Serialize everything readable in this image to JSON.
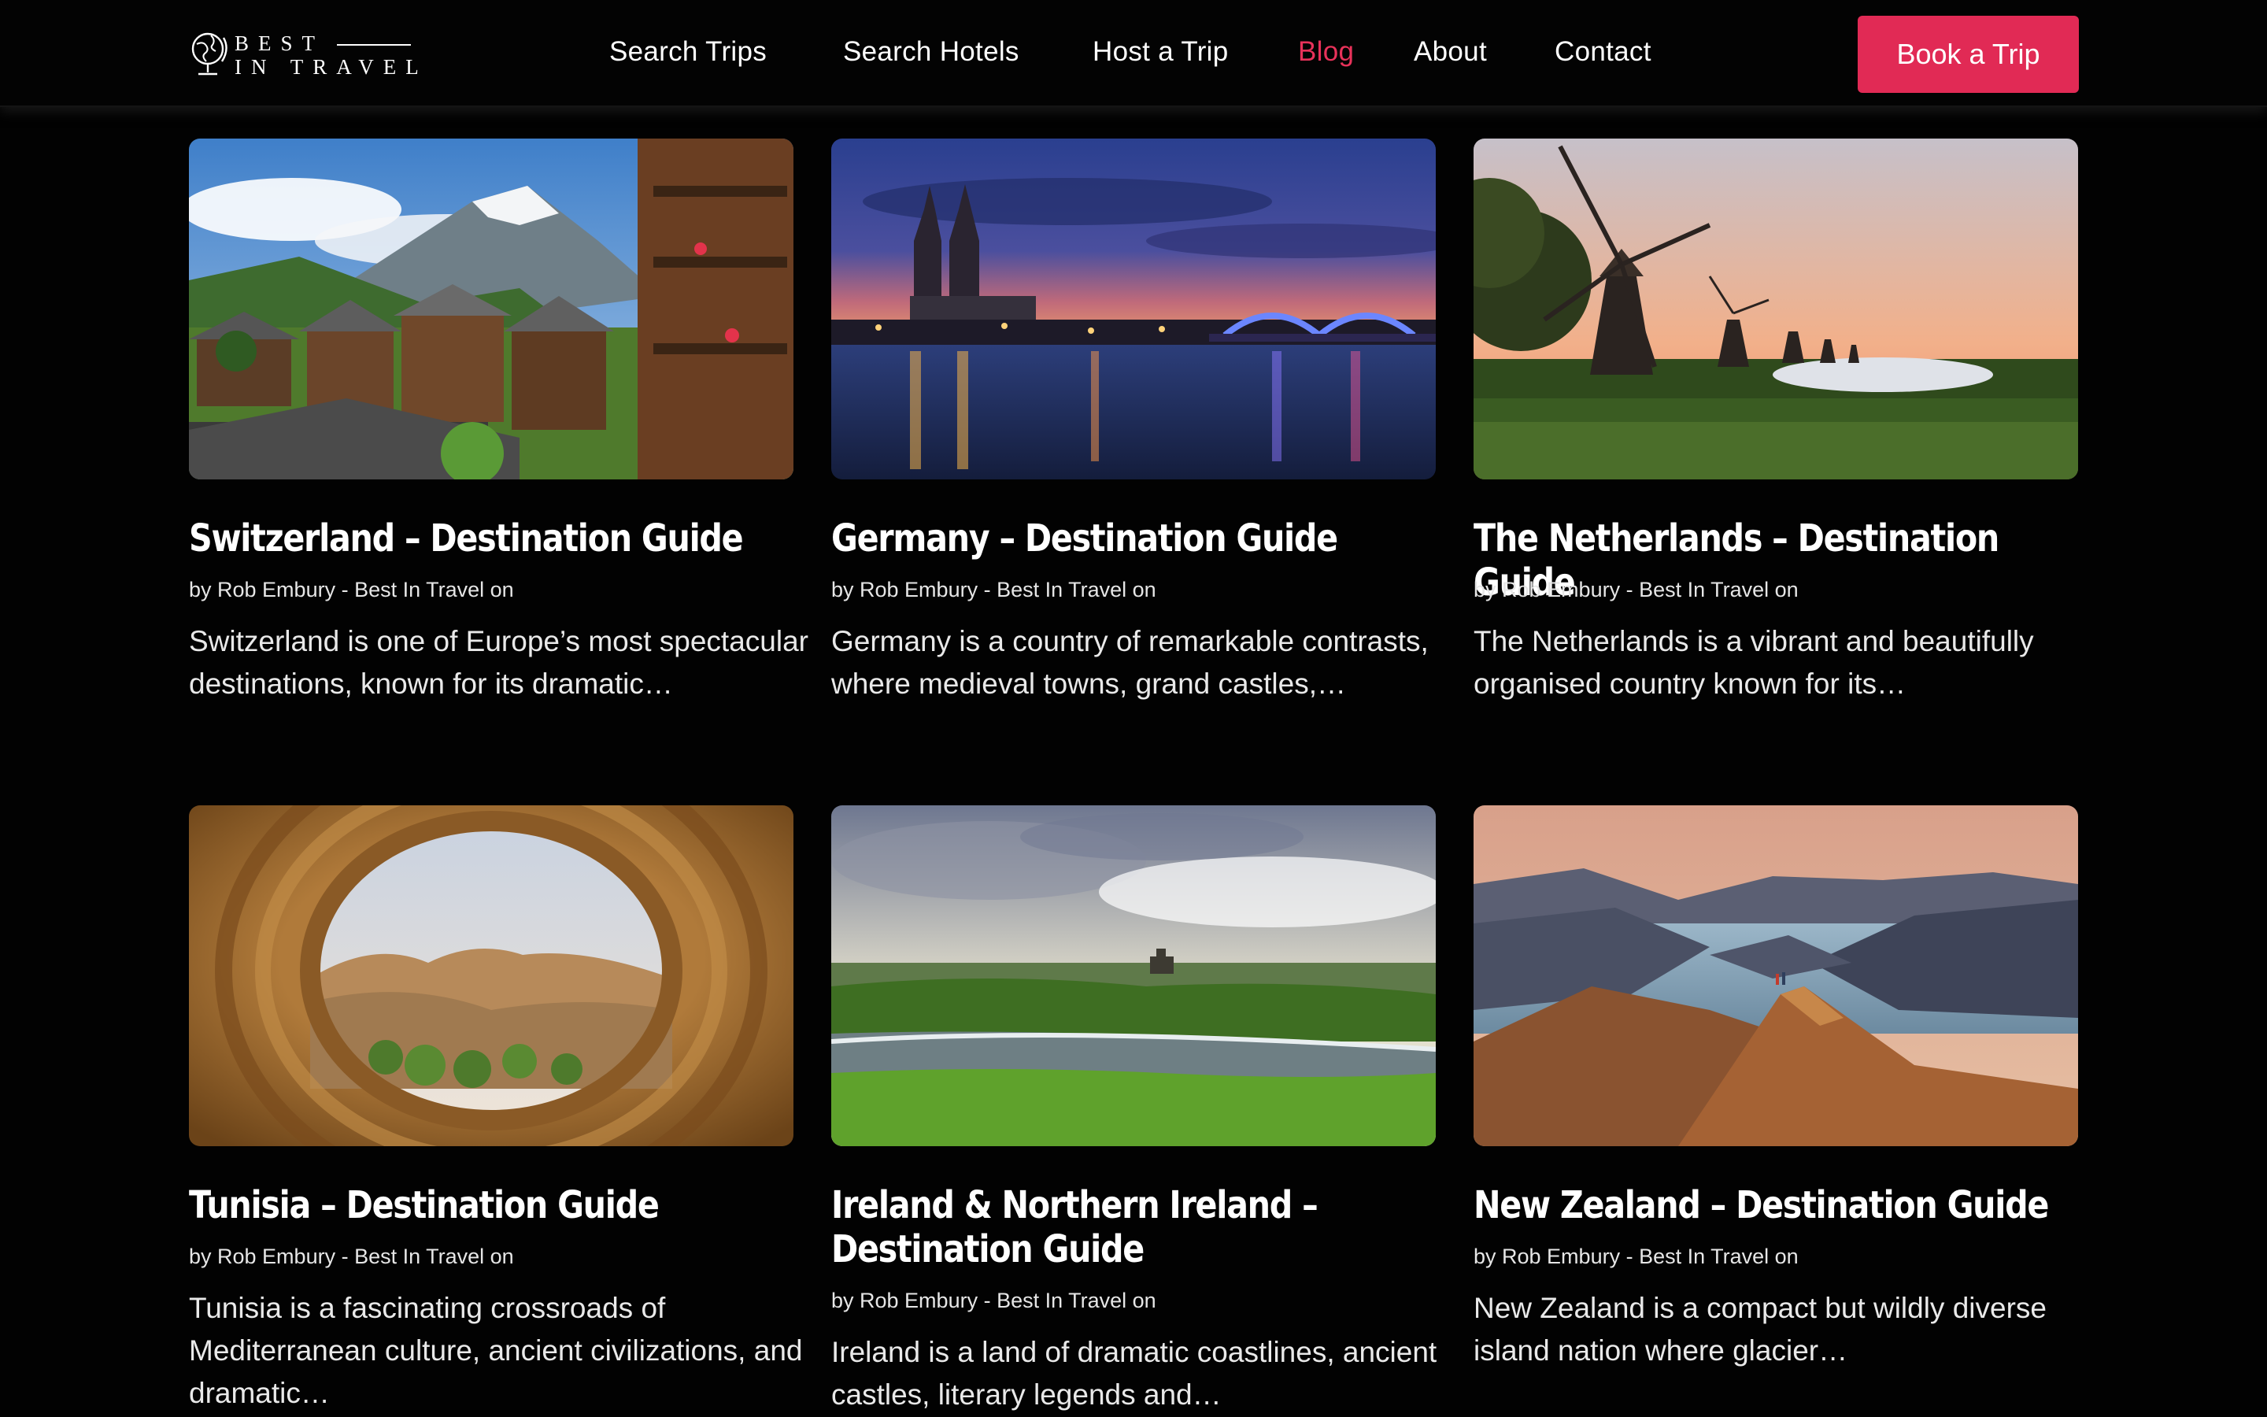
{
  "brand": {
    "line1": "BEST",
    "line2": "IN TRAVEL",
    "accent_color": "#e12a55",
    "logo_icon": "globe-icon"
  },
  "nav": {
    "items": [
      {
        "label": "Search Trips"
      },
      {
        "label": "Search Hotels"
      },
      {
        "label": "Host a Trip"
      },
      {
        "label": "Blog",
        "active": true
      },
      {
        "label": "About"
      },
      {
        "label": "Contact"
      }
    ],
    "cta_label": "Book a Trip"
  },
  "posts": [
    {
      "title": "Switzerland – Destination Guide",
      "meta": "by Rob Embury - Best In Travel on",
      "excerpt": "Switzerland is one of Europe’s most spectacular destinations, known for its dramatic…",
      "image": "alpine-village-photo"
    },
    {
      "title": "Germany – Destination Guide",
      "meta": "by Rob Embury - Best In Travel on",
      "excerpt": "Germany is a country of remarkable contrasts, where medieval towns, grand castles,…",
      "image": "cologne-cathedral-night-photo"
    },
    {
      "title": "The Netherlands – Destination Guide",
      "meta": "by Rob Embury - Best In Travel on",
      "excerpt": "The Netherlands is a vibrant and beautifully organised country known for its…",
      "image": "windmills-sunset-photo"
    },
    {
      "title": "Tunisia – Destination Guide",
      "meta": "by Rob Embury - Best In Travel on",
      "excerpt": "Tunisia is a fascinating crossroads of Mediterranean culture, ancient civilizations, and dramatic…",
      "image": "desert-oasis-through-stone-well-photo"
    },
    {
      "title": "Ireland & Northern Ireland – Destination Guide",
      "meta": "by Rob Embury - Best In Travel on",
      "excerpt": "Ireland is a land of dramatic coastlines, ancient castles, literary legends and…",
      "image": "irish-coast-castle-photo"
    },
    {
      "title": "New Zealand – Destination Guide",
      "meta": "by Rob Embury - Best In Travel on",
      "excerpt": "New Zealand is a compact but wildly diverse island nation where glacier…",
      "image": "mountain-lake-hikers-photo"
    }
  ]
}
